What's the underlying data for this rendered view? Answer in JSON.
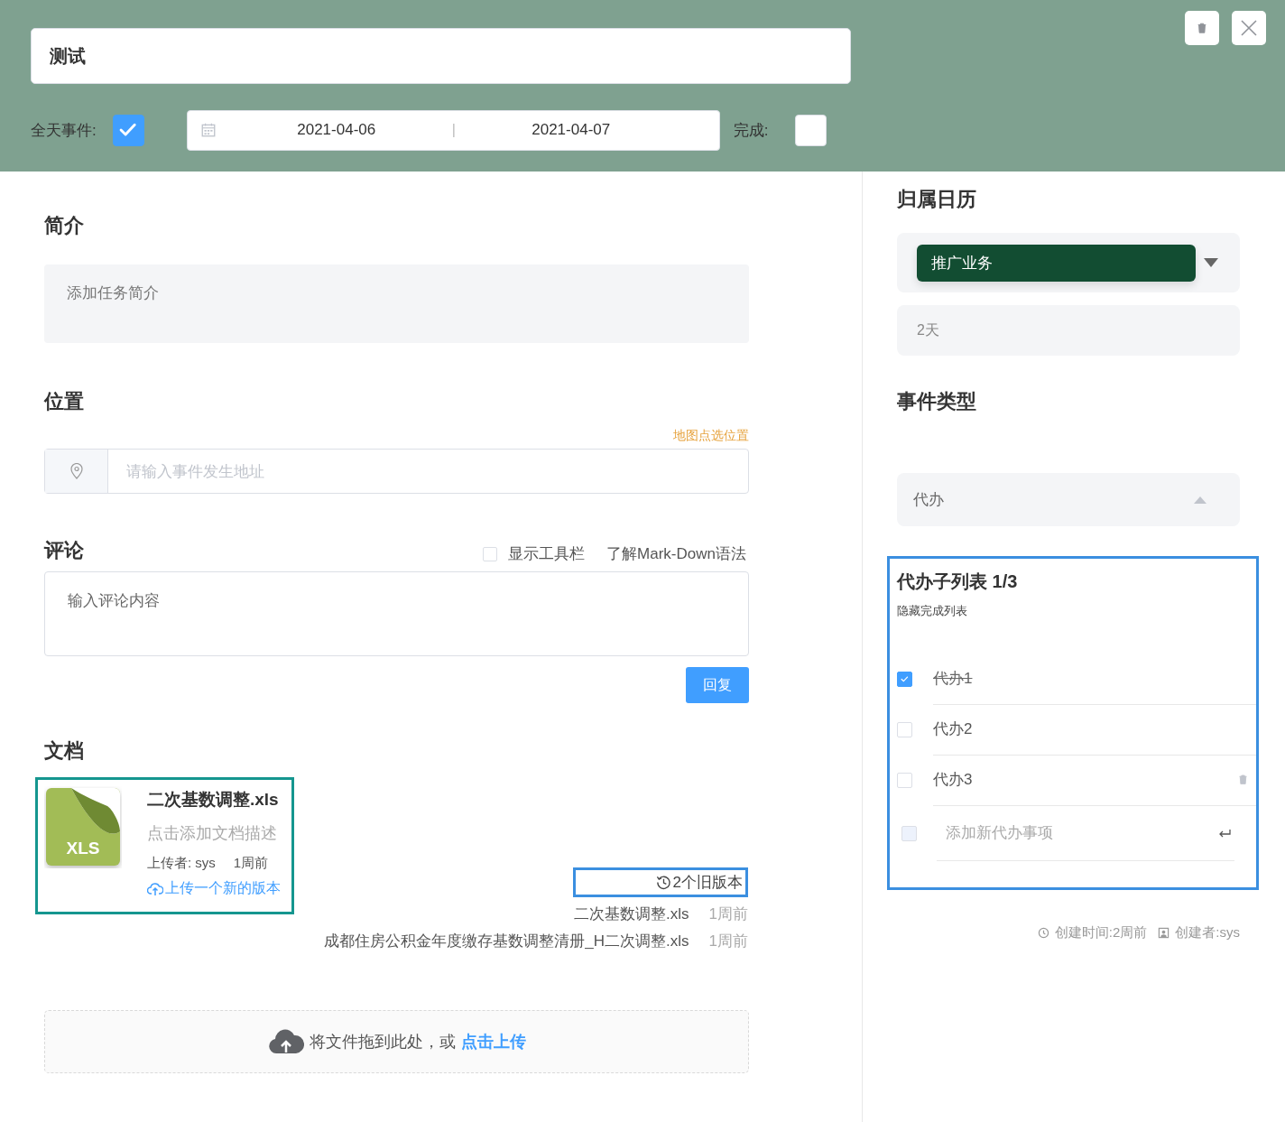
{
  "header": {
    "title": "测试",
    "all_day": {
      "label": "全天事件:",
      "checked": true
    },
    "date_range": {
      "start": "2021-04-06",
      "separator": "|",
      "end": "2021-04-07"
    },
    "done": {
      "label": "完成:",
      "checked": false
    }
  },
  "intro": {
    "heading": "简介",
    "placeholder": "添加任务简介"
  },
  "location": {
    "heading": "位置",
    "map_link": "地图点选位置",
    "placeholder": "请输入事件发生地址"
  },
  "comments": {
    "heading": "评论",
    "toolbar": {
      "label": "显示工具栏",
      "checked": false
    },
    "markdown_link": "了解Mark-Down语法",
    "placeholder": "输入评论内容",
    "reply_button": "回复"
  },
  "documents": {
    "heading": "文档",
    "file": {
      "type_label": "XLS",
      "name": "二次基数调整.xls",
      "description_placeholder": "点击添加文档描述",
      "uploader": "上传者: sys",
      "time": "1周前",
      "upload_new": "上传一个新的版本"
    },
    "old_versions": {
      "label": "2个旧版本",
      "items": [
        {
          "name": "二次基数调整.xls",
          "time": "1周前"
        },
        {
          "name": "成都住房公积金年度缴存基数调整清册_H二次调整.xls",
          "time": "1周前"
        }
      ]
    },
    "dropzone": {
      "text": "将文件拖到此处，或",
      "link": "点击上传"
    }
  },
  "sidebar": {
    "calendar": {
      "heading": "归属日历",
      "value": "推广业务"
    },
    "duration": "2天",
    "event_type": {
      "heading": "事件类型",
      "value": "代办",
      "expanded": true
    },
    "todos": {
      "title": "代办子列表 1/3",
      "hide_done": "隐藏完成列表",
      "items": [
        {
          "text": "代办1",
          "checked": true,
          "hovered": false
        },
        {
          "text": "代办2",
          "checked": false,
          "hovered": false
        },
        {
          "text": "代办3",
          "checked": false,
          "hovered": true
        }
      ],
      "new_item": {
        "placeholder": "添加新代办事项",
        "checked": false
      }
    },
    "footer": {
      "created": "创建时间:2周前",
      "creator": "创建者:sys"
    }
  }
}
